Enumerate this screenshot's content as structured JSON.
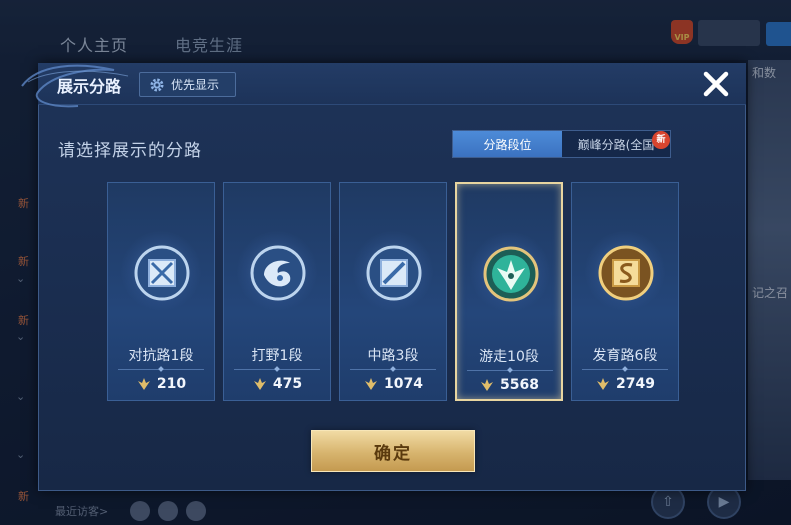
{
  "background": {
    "tabs": [
      "个人主页",
      "电竞生涯"
    ],
    "vip_label": "VIP",
    "right_texts": [
      "和数",
      "记之召"
    ],
    "left_marks": [
      "新",
      "新",
      "新",
      "新"
    ],
    "bottom_text": "最近访客>"
  },
  "modal": {
    "title": "展示分路",
    "priority_button": "优先显示",
    "section_title": "请选择展示的分路",
    "toggle": {
      "active": "分路段位",
      "inactive": "巅峰分路(全国",
      "new_badge": "新"
    },
    "cards": [
      {
        "name": "对抗路1段",
        "score": "210",
        "selected": false,
        "emblem": "clash-lane-emblem-icon",
        "color": "#bcd4ee"
      },
      {
        "name": "打野1段",
        "score": "475",
        "selected": false,
        "emblem": "jungle-emblem-icon",
        "color": "#bcd4ee"
      },
      {
        "name": "中路3段",
        "score": "1074",
        "selected": false,
        "emblem": "mid-lane-emblem-icon",
        "color": "#bcd4ee"
      },
      {
        "name": "游走10段",
        "score": "5568",
        "selected": true,
        "emblem": "roam-emblem-icon",
        "color": "#2fb39a"
      },
      {
        "name": "发育路6段",
        "score": "2749",
        "selected": false,
        "emblem": "farm-lane-emblem-icon",
        "color": "#e8b457"
      }
    ],
    "confirm_button": "确定"
  },
  "colors": {
    "accent_blue": "#3b72c0",
    "gold": "#d7b46e",
    "selected_border": "#e8d5a0"
  }
}
